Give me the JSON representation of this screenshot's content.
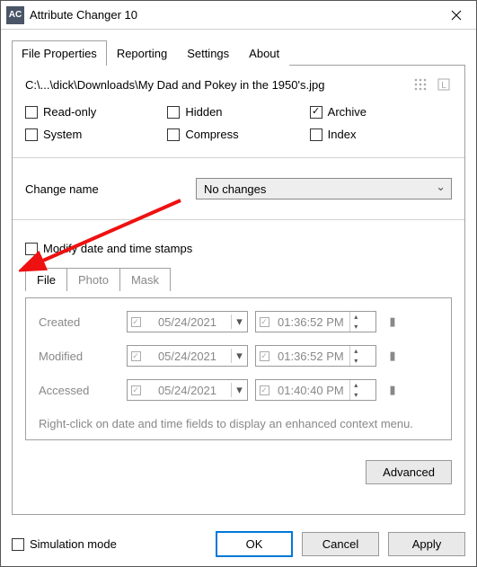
{
  "window": {
    "app_icon_text": "AC",
    "title": "Attribute Changer 10"
  },
  "tabs": {
    "items": [
      {
        "label": "File Properties"
      },
      {
        "label": "Reporting"
      },
      {
        "label": "Settings"
      },
      {
        "label": "About"
      }
    ]
  },
  "path": "C:\\...\\dick\\Downloads\\My Dad and Pokey in the 1950's.jpg",
  "attributes": {
    "readonly": "Read-only",
    "hidden": "Hidden",
    "archive": "Archive",
    "system": "System",
    "compress": "Compress",
    "index": "Index"
  },
  "change_name": {
    "label": "Change name",
    "selected": "No changes"
  },
  "modify": {
    "label": "Modify date and time stamps"
  },
  "subtabs": {
    "items": [
      {
        "label": "File"
      },
      {
        "label": "Photo"
      },
      {
        "label": "Mask"
      }
    ]
  },
  "dates": {
    "created": {
      "label": "Created",
      "date": "05/24/2021",
      "time": "01:36:52  PM"
    },
    "modified": {
      "label": "Modified",
      "date": "05/24/2021",
      "time": "01:36:52  PM"
    },
    "accessed": {
      "label": "Accessed",
      "date": "05/24/2021",
      "time": "01:40:40  PM"
    }
  },
  "hint": "Right-click on date and time fields to display an enhanced context menu.",
  "buttons": {
    "advanced": "Advanced",
    "ok": "OK",
    "cancel": "Cancel",
    "apply": "Apply"
  },
  "footer": {
    "simulation": "Simulation mode"
  }
}
